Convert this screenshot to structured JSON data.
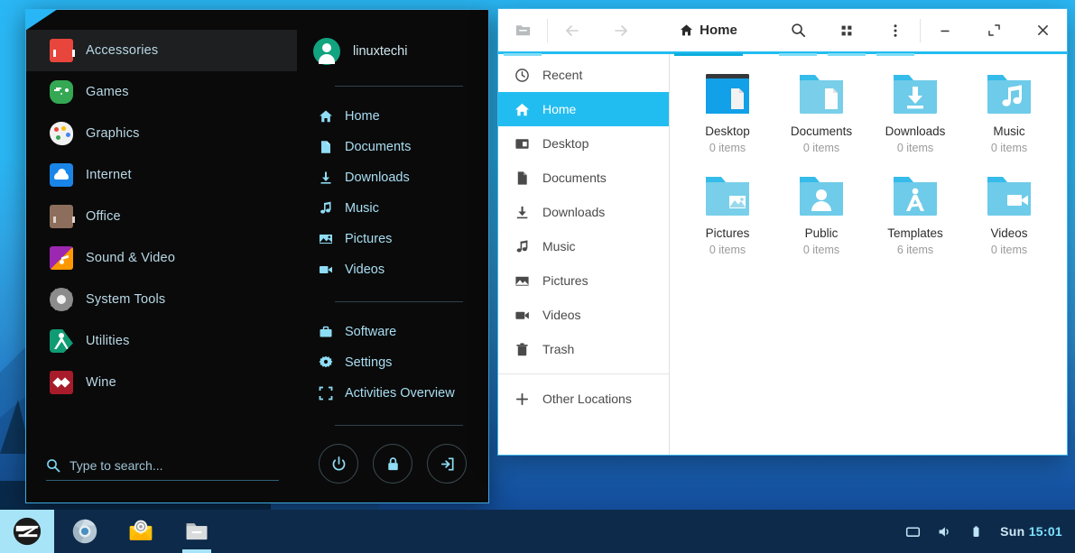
{
  "desktop": {
    "wallpaper_sky_color": "#2ab7f5",
    "wallpaper_deep_color": "#0f3c7e"
  },
  "app_menu": {
    "categories": [
      {
        "label": "Accessories",
        "icon": "toolbox-icon",
        "active": true
      },
      {
        "label": "Games",
        "icon": "gamepad-icon",
        "active": false
      },
      {
        "label": "Graphics",
        "icon": "palette-icon",
        "active": false
      },
      {
        "label": "Internet",
        "icon": "cloud-icon",
        "active": false
      },
      {
        "label": "Office",
        "icon": "briefcase-icon",
        "active": false
      },
      {
        "label": "Sound & Video",
        "icon": "music-video-icon",
        "active": false
      },
      {
        "label": "System Tools",
        "icon": "gear-icon",
        "active": false
      },
      {
        "label": "Utilities",
        "icon": "compass-icon",
        "active": false
      },
      {
        "label": "Wine",
        "icon": "wine-diamond-icon",
        "active": false
      }
    ],
    "search": {
      "placeholder": "Type to search...",
      "value": ""
    },
    "user": {
      "name": "linuxtechi",
      "avatar_color": "#12a37f"
    },
    "places": [
      {
        "label": "Home",
        "icon": "home-icon"
      },
      {
        "label": "Documents",
        "icon": "document-icon"
      },
      {
        "label": "Downloads",
        "icon": "download-icon"
      },
      {
        "label": "Music",
        "icon": "music-note-icon"
      },
      {
        "label": "Pictures",
        "icon": "image-icon"
      },
      {
        "label": "Videos",
        "icon": "video-camera-icon"
      }
    ],
    "system": [
      {
        "label": "Software",
        "icon": "software-bag-icon"
      },
      {
        "label": "Settings",
        "icon": "gear-icon"
      },
      {
        "label": "Activities Overview",
        "icon": "overview-icon"
      }
    ],
    "power_buttons": [
      {
        "name": "shutdown-button",
        "icon": "power-icon"
      },
      {
        "name": "lock-button",
        "icon": "lock-icon"
      },
      {
        "name": "logout-button",
        "icon": "logout-icon"
      }
    ]
  },
  "files_window": {
    "header": {
      "title": "Home",
      "title_icon": "home-icon",
      "sidebar_toggle_icon": "folder-toggle-icon",
      "back_icon": "arrow-left-icon",
      "forward_icon": "arrow-right-icon",
      "search_icon": "search-icon",
      "view_grid_icon": "grid-view-icon",
      "menu_icon": "kebab-menu-icon",
      "minimize_icon": "minimize-icon",
      "maximize_icon": "maximize-icon",
      "close_icon": "close-icon"
    },
    "sidebar": [
      {
        "label": "Recent",
        "icon": "clock-icon",
        "active": false
      },
      {
        "label": "Home",
        "icon": "home-icon",
        "active": true
      },
      {
        "label": "Desktop",
        "icon": "desktop-icon",
        "active": false
      },
      {
        "label": "Documents",
        "icon": "document-icon",
        "active": false
      },
      {
        "label": "Downloads",
        "icon": "download-icon",
        "active": false
      },
      {
        "label": "Music",
        "icon": "music-note-icon",
        "active": false
      },
      {
        "label": "Pictures",
        "icon": "image-icon",
        "active": false
      },
      {
        "label": "Videos",
        "icon": "video-camera-icon",
        "active": false
      },
      {
        "label": "Trash",
        "icon": "trash-icon",
        "active": false
      }
    ],
    "sidebar_footer": {
      "label": "Other Locations",
      "icon": "plus-icon"
    },
    "files": [
      {
        "name": "Desktop",
        "count": "0 items",
        "icon": "desktop-folder-icon"
      },
      {
        "name": "Documents",
        "count": "0 items",
        "icon": "documents-folder-icon"
      },
      {
        "name": "Downloads",
        "count": "0 items",
        "icon": "downloads-folder-icon"
      },
      {
        "name": "Music",
        "count": "0 items",
        "icon": "music-folder-icon"
      },
      {
        "name": "Pictures",
        "count": "0 items",
        "icon": "pictures-folder-icon"
      },
      {
        "name": "Public",
        "count": "0 items",
        "icon": "public-folder-icon"
      },
      {
        "name": "Templates",
        "count": "6 items",
        "icon": "templates-folder-icon"
      },
      {
        "name": "Videos",
        "count": "0 items",
        "icon": "videos-folder-icon"
      }
    ],
    "accent_color": "#22bdf0"
  },
  "taskbar": {
    "start_button": {
      "name": "zorin-menu-button",
      "icon": "zorin-logo-icon"
    },
    "apps": [
      {
        "name": "chromium",
        "icon": "chromium-icon",
        "running": false
      },
      {
        "name": "mail",
        "icon": "mail-icon",
        "running": false
      },
      {
        "name": "files",
        "icon": "files-icon",
        "running": true
      }
    ],
    "tray": [
      {
        "name": "display-indicator",
        "icon": "display-icon"
      },
      {
        "name": "volume-indicator",
        "icon": "speaker-icon"
      },
      {
        "name": "battery-indicator",
        "icon": "battery-icon"
      }
    ],
    "clock": {
      "day": "Sun",
      "time": "15:01"
    }
  }
}
